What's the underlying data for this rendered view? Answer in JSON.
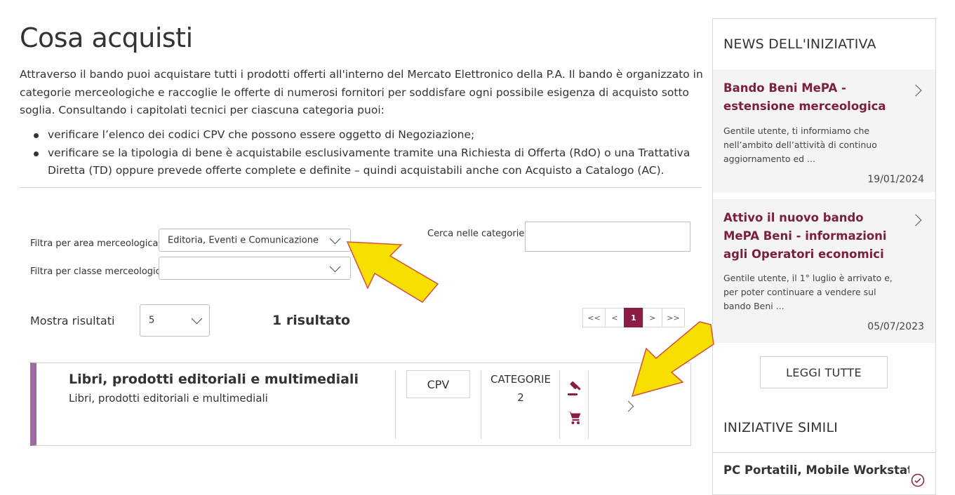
{
  "page": {
    "title": "Cosa acquisti",
    "intro": "Attraverso il bando puoi acquistare tutti i prodotti offerti all'interno del Mercato Elettronico della P.A. Il bando è organizzato in categorie merceologiche e raccoglie le offerte di numerosi fornitori per soddisfare ogni possibile esigenza di acquisto sotto soglia. Consultando i capitolati tecnici per ciascuna categoria puoi:",
    "bullets": [
      "verificare l’elenco dei codici CPV che possono essere oggetto di Negoziazione;",
      "verificare se la tipologia di bene è acquistabile esclusivamente tramite una Richiesta di Offerta (RdO) o una Trattativa Diretta (TD) oppure prevede offerte complete e definite – quindi acquistabili anche con Acquisto a Catalogo (AC)."
    ]
  },
  "filters": {
    "area_label": "Filtra per area merceologica",
    "area_value": "Editoria, Eventi e Comunicazione",
    "class_label": "Filtra per classe merceologica",
    "class_value": "",
    "search_label": "Cerca nelle categorie",
    "search_value": ""
  },
  "results": {
    "show_label": "Mostra risultati",
    "per_page": "5",
    "count_text": "1 risultato",
    "pager": [
      "<<",
      "<",
      "1",
      ">",
      ">>"
    ],
    "current_page": "1"
  },
  "result_card": {
    "title": "Libri, prodotti editoriali e multimediali",
    "subtitle": "Libri, prodotti editoriali e multimediali",
    "cpv_label": "CPV",
    "categorie_label": "CATEGORIE",
    "categorie_count": "2"
  },
  "sidebar": {
    "news_heading": "NEWS DELL'INIZIATIVA",
    "news": [
      {
        "title": "Bando Beni MePA - estensione merceologica",
        "text": "Gentile utente, ti informiamo che nell’ambito dell’attività di continuo aggiornamento ed ...",
        "date": "19/01/2024"
      },
      {
        "title": "Attivo il nuovo bando MePA Beni - informazioni agli Operatori economici",
        "text": "Gentile utente, il 1° luglio è arrivato e, per poter continuare a vendere sul bando Beni ...",
        "date": "05/07/2023"
      }
    ],
    "read_all_label": "LEGGI TUTTE",
    "similar_heading": "INIZIATIVE SIMILI",
    "similar_first": "PC Portatili, Mobile Workstation e"
  },
  "colors": {
    "accent": "#7b1f3d",
    "pager_active": "#8a1c45",
    "card_stripe": "#9e6aa2",
    "arrow_fill": "#f7df00",
    "arrow_stroke": "#d4503a"
  }
}
